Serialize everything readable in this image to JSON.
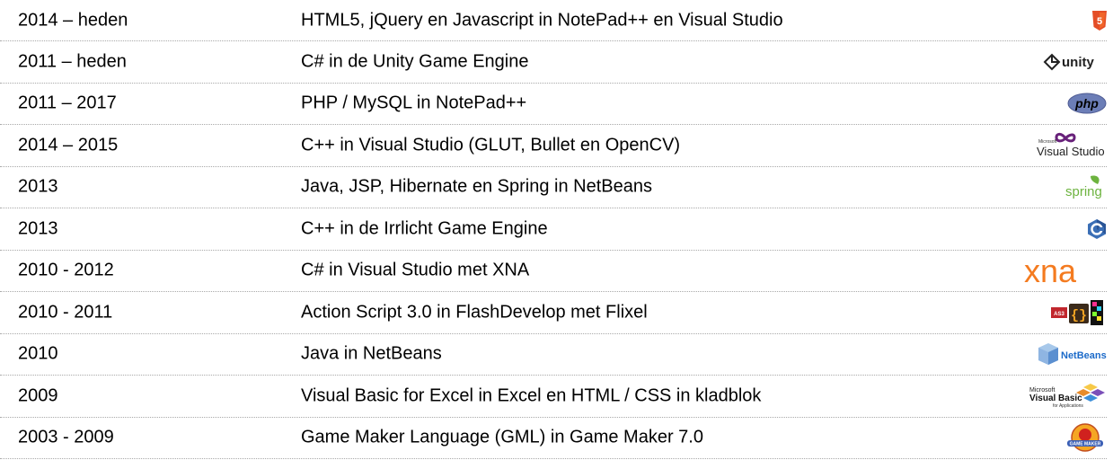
{
  "rows": [
    {
      "years": "2014 – heden",
      "description": "HTML5, jQuery en Javascript in NotePad++ en Visual Studio",
      "logo": "html5-icon"
    },
    {
      "years": "2011 – heden",
      "description": "C# in de Unity Game Engine",
      "logo": "unity-logo",
      "logo_text": "unity"
    },
    {
      "years": "2011 – 2017",
      "description": "PHP / MySQL in NotePad++",
      "logo": "php-logo",
      "logo_text": "php"
    },
    {
      "years": "2014 – 2015",
      "description": "C++ in Visual Studio (GLUT, Bullet en OpenCV)",
      "logo": "visual-studio-logo",
      "logo_text": "Visual Studio",
      "logo_small_text": "Microsoft"
    },
    {
      "years": "2013",
      "description": "Java, JSP, Hibernate en Spring in NetBeans",
      "logo": "spring-logo",
      "logo_text": "spring"
    },
    {
      "years": "2013",
      "description": "C++ in de Irrlicht Game Engine",
      "logo": "cpp-icon"
    },
    {
      "years": "2010 - 2012",
      "description": "C# in Visual Studio met XNA",
      "logo": "xna-logo",
      "logo_text": "xna"
    },
    {
      "years": "2010 - 2011",
      "description": "Action Script 3.0 in FlashDevelop met Flixel",
      "logo": "as3-flashdevelop-flixel-icons",
      "logo_text": "AS3"
    },
    {
      "years": "2010",
      "description": "Java in NetBeans",
      "logo": "netbeans-logo",
      "logo_text": "NetBeans"
    },
    {
      "years": "2009",
      "description": "Visual Basic for Excel in Excel en HTML / CSS in kladblok",
      "logo": "visual-basic-logo",
      "logo_text": "Visual Basic",
      "logo_small_text": "Microsoft",
      "logo_sub_text": "for Applications"
    },
    {
      "years": "2003 - 2009",
      "description": "Game Maker Language (GML) in Game Maker 7.0",
      "logo": "game-maker-logo",
      "logo_text": "GAME MAKER"
    }
  ],
  "colors": {
    "html5": "#e44d26",
    "php": "#6c7eb7",
    "spring": "#6db33f",
    "cpp": "#3b6fb6",
    "xna": "#f47b20",
    "visual_studio": "#68217a",
    "netbeans": "#1b6ac9",
    "row_divider": "#a9a9a9"
  }
}
